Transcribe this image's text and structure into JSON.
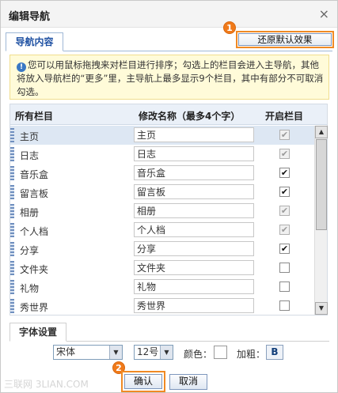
{
  "dialog": {
    "title": "编辑导航",
    "close": "×"
  },
  "tabs": {
    "nav": "导航内容",
    "font": "字体设置"
  },
  "restore_button": "还原默认效果",
  "badges": {
    "one": "1",
    "two": "2"
  },
  "notice": {
    "icon": "!",
    "text": "您可以用鼠标拖拽来对栏目进行排序；勾选上的栏目会进入主导航，其他将放入导航栏的“更多”里，主导航上最多显示9个栏目，其中有部分不可取消勾选。"
  },
  "table": {
    "headers": {
      "all": "所有栏目",
      "rename": "修改名称（最多4个字）",
      "enable": "开启栏目"
    },
    "rows": [
      {
        "name": "主页",
        "value": "主页",
        "check": "✔",
        "state": "disabled"
      },
      {
        "name": "日志",
        "value": "日志",
        "check": "✔",
        "state": "disabled"
      },
      {
        "name": "音乐盒",
        "value": "音乐盒",
        "check": "✔",
        "state": "checked"
      },
      {
        "name": "留言板",
        "value": "留言板",
        "check": "✔",
        "state": "checked"
      },
      {
        "name": "相册",
        "value": "相册",
        "check": "✔",
        "state": "disabled"
      },
      {
        "name": "个人档",
        "value": "个人档",
        "check": "✔",
        "state": "disabled"
      },
      {
        "name": "分享",
        "value": "分享",
        "check": "✔",
        "state": "checked"
      },
      {
        "name": "文件夹",
        "value": "文件夹",
        "check": "",
        "state": "unchecked"
      },
      {
        "name": "礼物",
        "value": "礼物",
        "check": "",
        "state": "unchecked"
      },
      {
        "name": "秀世界",
        "value": "秀世界",
        "check": "",
        "state": "unchecked"
      }
    ]
  },
  "font_settings": {
    "font": "宋体",
    "size": "12号",
    "color_label": "颜色：",
    "bold_label": "加粗：",
    "bold_button": "B"
  },
  "buttons": {
    "ok": "确认",
    "cancel": "取消"
  },
  "watermark": "三联网 3LIAN.COM",
  "colors": {
    "accent": "#f08a24",
    "tab_text": "#1e50a2",
    "notice_bg": "#fffbd9"
  }
}
